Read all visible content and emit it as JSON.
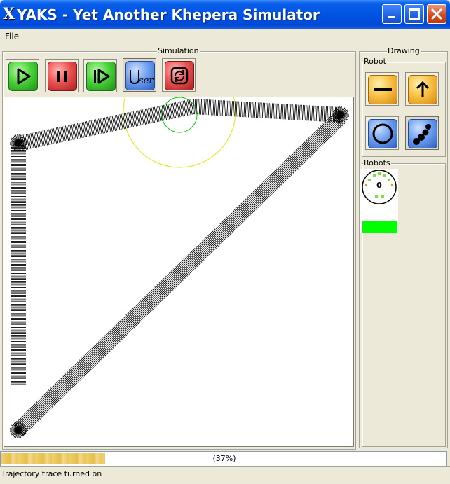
{
  "window": {
    "title": "YAKS - Yet Another Khepera Simulator",
    "app_icon_glyph": "X",
    "buttons": [
      "minimize",
      "maximize",
      "close"
    ]
  },
  "menu": {
    "items": [
      {
        "label": "File"
      }
    ]
  },
  "simulation": {
    "group_title": "Simulation",
    "tools": [
      {
        "name": "play",
        "icon": "play-icon",
        "color": "green"
      },
      {
        "name": "pause",
        "icon": "pause-icon",
        "color": "red"
      },
      {
        "name": "step",
        "icon": "step-icon",
        "color": "green"
      },
      {
        "name": "user",
        "icon": "user-icon",
        "color": "blue",
        "label": "User"
      },
      {
        "name": "reset",
        "icon": "reset-icon",
        "color": "red"
      }
    ]
  },
  "drawing": {
    "group_title": "Drawing",
    "robot_group_title": "Robot",
    "robot_tools": [
      {
        "name": "wall",
        "icon": "wall-icon",
        "color": "orange"
      },
      {
        "name": "direction",
        "icon": "arrow-up-icon",
        "color": "orange"
      },
      {
        "name": "circle",
        "icon": "circle-icon",
        "color": "blue"
      },
      {
        "name": "dots",
        "icon": "dots-icon",
        "color": "blue"
      }
    ],
    "robots_group_title": "Robots",
    "robots": [
      {
        "id": "0",
        "energy": 1.0,
        "energy_color": "#00ff00"
      }
    ]
  },
  "progress": {
    "value": 0.37,
    "text": "(37%)"
  },
  "status": {
    "text": "Trajectory trace turned on"
  },
  "colors": {
    "titlebar": "#0054e3",
    "trail": "#000000",
    "range_circle": "#e6e600",
    "sensor_circle": "#00cc00",
    "progress": "#e6be4a"
  }
}
